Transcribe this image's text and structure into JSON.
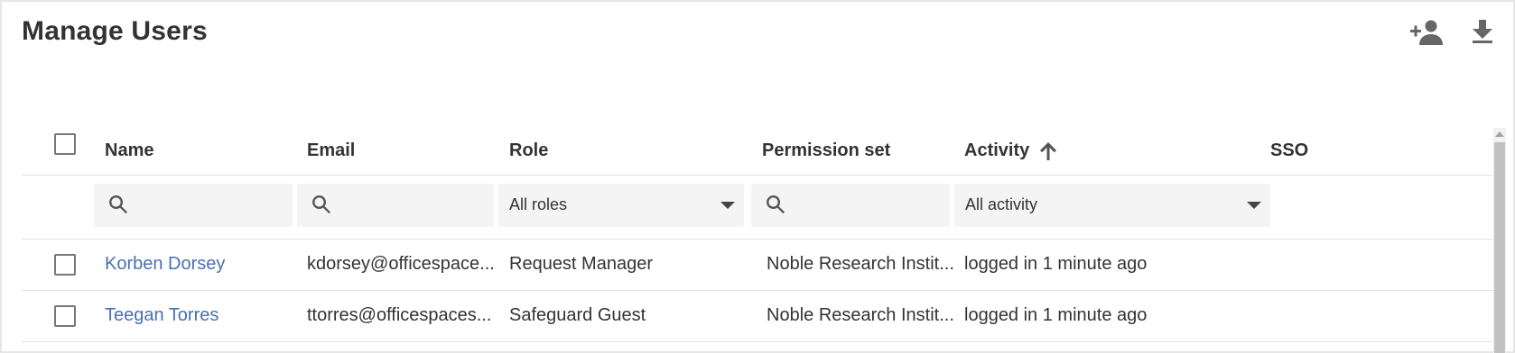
{
  "page": {
    "title": "Manage Users",
    "actions": {
      "add_user_icon": "person-add-icon",
      "download_icon": "download-icon"
    }
  },
  "table": {
    "columns": {
      "name": "Name",
      "email": "Email",
      "role": "Role",
      "permission_set": "Permission set",
      "activity": "Activity",
      "sso": "SSO"
    },
    "sort": {
      "column": "activity",
      "direction": "ascending"
    },
    "filters": {
      "name": {
        "value": "",
        "placeholder": ""
      },
      "email": {
        "value": "",
        "placeholder": ""
      },
      "role": {
        "selected": "All roles"
      },
      "permission_set": {
        "value": "",
        "placeholder": ""
      },
      "activity": {
        "selected": "All activity"
      }
    },
    "rows": [
      {
        "name": "Korben Dorsey",
        "email": "kdorsey@officespace...",
        "role": "Request Manager",
        "permission_set": "Noble Research Instit...",
        "activity": "logged in 1 minute ago",
        "sso": ""
      },
      {
        "name": "Teegan Torres",
        "email": "ttorres@officespaces...",
        "role": "Safeguard Guest",
        "permission_set": "Noble Research Instit...",
        "activity": "logged in 1 minute ago",
        "sso": ""
      }
    ]
  },
  "colors": {
    "link": "#4a6fb3",
    "text": "#333333",
    "filter_bg": "#f4f4f4"
  }
}
